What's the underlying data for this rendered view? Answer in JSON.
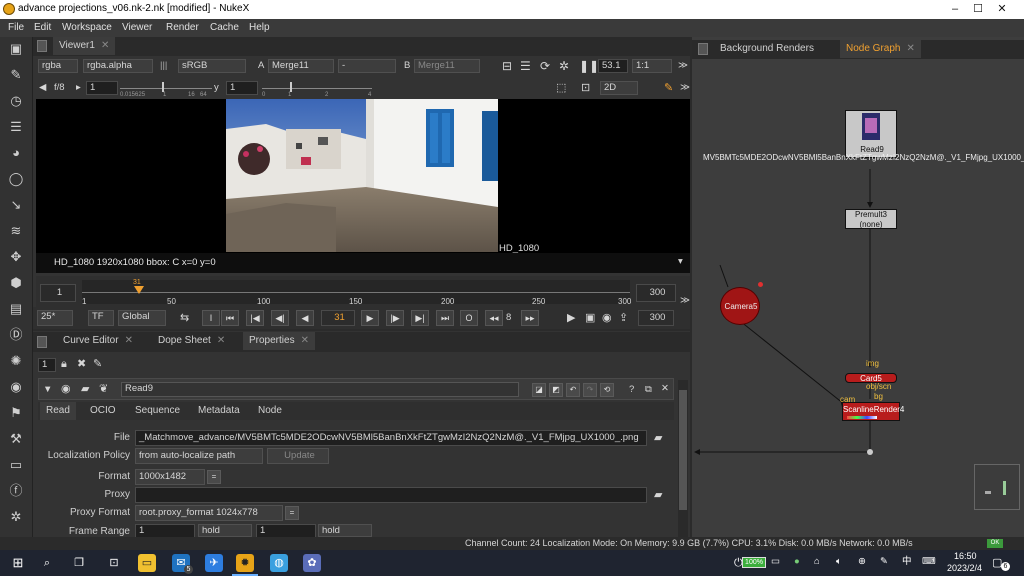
{
  "window": {
    "title": "advance projections_v06.nk-2.nk [modified] - NukeX",
    "min": "–",
    "max": "☐",
    "close": "✕"
  },
  "menu": [
    "File",
    "Edit",
    "Workspace",
    "Viewer",
    "Render",
    "Cache",
    "Help"
  ],
  "viewer": {
    "tab": "Viewer1",
    "channels": "rgba",
    "alpha": "rgba.alpha",
    "lut_prefix": "sRGB",
    "lut_value": "sRGB",
    "a_label": "A",
    "a_input": "Merge11",
    "dash": "-",
    "b_label": "B",
    "b_input": "Merge11",
    "zoom": "53.1",
    "proxy": "1:1",
    "fstop": "f/8",
    "gain_value": "1",
    "gain_ticks": [
      "0.015625",
      "1",
      "16",
      "64"
    ],
    "gamma_label": "y",
    "gamma_value": "1",
    "gamma_ticks": [
      "0",
      "1",
      "2",
      "4"
    ],
    "view_mode": "2D",
    "format_label": "HD_1080",
    "info_line": "HD_1080 1920x1080  bbox: C  x=0 y=0"
  },
  "timeline": {
    "start_box": "1",
    "end_box": "300",
    "ticks": [
      "1",
      "50",
      "100",
      "150",
      "200",
      "250",
      "300"
    ],
    "current_frame_marker": "31",
    "fps": "25*",
    "tf": "TF",
    "global": "Global",
    "i_btn": "I",
    "o_btn": "O",
    "current_frame": "31",
    "step": "8",
    "end_frame": "300"
  },
  "lower_tabs": [
    "Curve Editor",
    "Dope Sheet",
    "Properties"
  ],
  "properties": {
    "max_panels": "1",
    "node_name": "Read9",
    "subtabs": [
      "Read",
      "OCIO",
      "Sequence",
      "Metadata",
      "Node"
    ],
    "file_label": "File",
    "file_value": "_Matchmove_advance/MV5BMTc5MDE2ODcwNV5BMl5BanBnXkFtZTgwMzI2NzQ2NzM@._V1_FMjpg_UX1000_.png",
    "localization_label": "Localization Policy",
    "localization_value": "from auto-localize path",
    "update_btn": "Update",
    "format_label": "Format",
    "format_value": "1000x1482",
    "proxy_label": "Proxy",
    "proxy_value": "",
    "proxy_format_label": "Proxy Format",
    "proxy_format_value": "root.proxy_format 1024x778",
    "frame_range_label": "Frame Range",
    "frame_range_first": "1",
    "frame_range_first_mode": "hold",
    "frame_range_last": "1",
    "frame_range_last_mode": "hold"
  },
  "right_tabs": [
    "Background Renders",
    "Node Graph"
  ],
  "nodes": {
    "read": "Read9",
    "read_path": "MV5BMTc5MDE2ODcwNV5BMl5BanBnXkFtZTgwMzI2NzQ2NzM@._V1_FMjpg_UX1000_",
    "premult": "Premult3",
    "premult_sub": "(none)",
    "camera": "Camera5",
    "card": "Card5",
    "scanline": "ScanlineRender4",
    "label_img": "img",
    "label_objscn": "obj/scn",
    "label_bg": "bg",
    "label_cam": "cam"
  },
  "status": "Channel Count: 24  Localization Mode: On  Memory: 9.9 GB (7.7%)  CPU: 3.1%  Disk: 0.0 MB/s  Network: 0.0 MB/s",
  "status_ok": "OK",
  "taskbar": {
    "battery": "100%",
    "ime": "中",
    "time": "16:50",
    "date": "2023/2/4",
    "notif": "6",
    "mail_badge": "5"
  },
  "colors": {
    "accent_orange": "#f0a030",
    "camera_red": "#a01515",
    "card_red": "#b81c1c"
  }
}
